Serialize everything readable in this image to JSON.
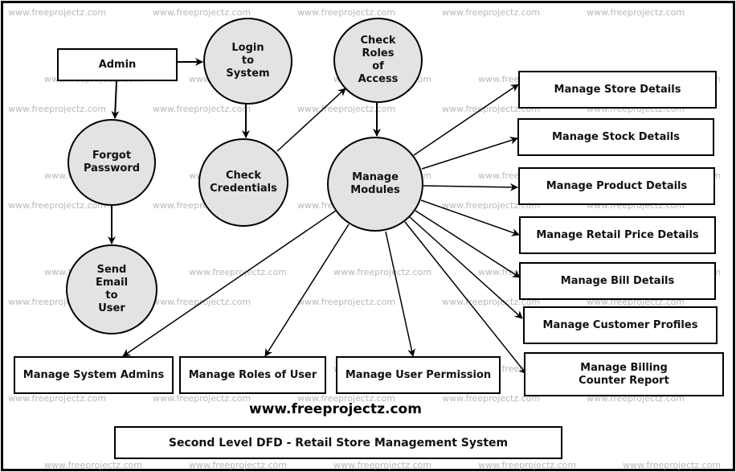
{
  "diagram": {
    "title": "Second Level DFD - Retail Store Management System",
    "website": "www.freeprojectz.com",
    "watermark": "www.freeprojectz.com",
    "colors": {
      "process_fill": "#e3e3e3",
      "stroke": "#000000",
      "watermark": "#b8b8b8"
    },
    "entities": {
      "admin": "Admin",
      "store": "Manage Store Details",
      "stock": "Manage Stock Details",
      "product": "Manage Product Details",
      "retail": "Manage Retail Price Details",
      "bill": "Manage Bill Details",
      "customer": "Manage Customer Profiles",
      "billing": "Manage Billing\nCounter  Report",
      "sysadmins": "Manage System Admins",
      "roles": "Manage Roles of User",
      "permission": "Manage User Permission"
    },
    "processes": {
      "login": "Login\nto\nSystem",
      "check_roles": "Check\nRoles\nof\nAccess",
      "forgot": "Forgot\nPassword",
      "check_credentials": "Check\nCredentials",
      "manage_modules": "Manage\nModules",
      "send_email": "Send\nEmail\nto\nUser"
    },
    "flows": [
      {
        "from": "admin",
        "to": "login"
      },
      {
        "from": "admin",
        "to": "forgot"
      },
      {
        "from": "login",
        "to": "check_credentials"
      },
      {
        "from": "check_credentials",
        "to": "check_roles"
      },
      {
        "from": "check_roles",
        "to": "manage_modules"
      },
      {
        "from": "forgot",
        "to": "send_email"
      },
      {
        "from": "manage_modules",
        "to": "store"
      },
      {
        "from": "manage_modules",
        "to": "stock"
      },
      {
        "from": "manage_modules",
        "to": "product"
      },
      {
        "from": "manage_modules",
        "to": "retail"
      },
      {
        "from": "manage_modules",
        "to": "bill"
      },
      {
        "from": "manage_modules",
        "to": "customer"
      },
      {
        "from": "manage_modules",
        "to": "billing"
      },
      {
        "from": "manage_modules",
        "to": "sysadmins"
      },
      {
        "from": "manage_modules",
        "to": "roles"
      },
      {
        "from": "manage_modules",
        "to": "permission"
      }
    ]
  }
}
